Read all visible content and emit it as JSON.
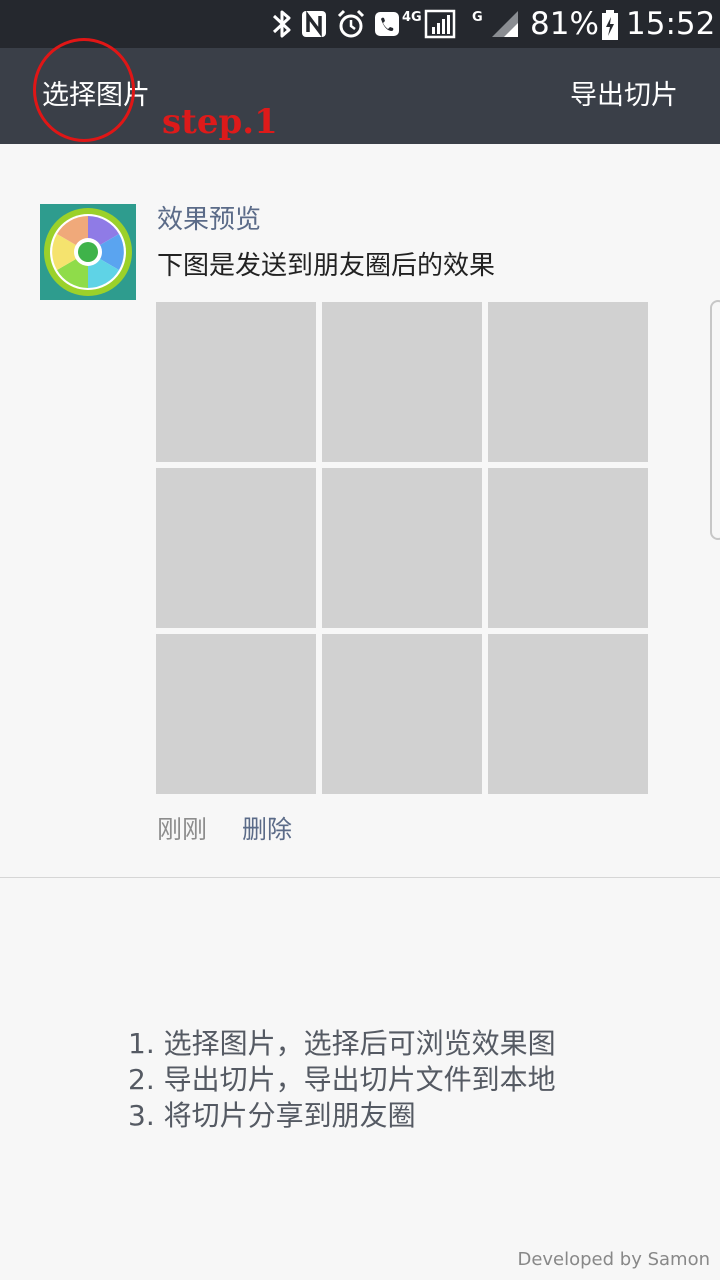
{
  "status_bar": {
    "icons": [
      "bluetooth-icon",
      "nfc-icon",
      "alarm-icon",
      "call-icon",
      "4g-signal-icon",
      "g-signal-icon",
      "battery-charging-icon"
    ],
    "network_label": "4G",
    "network2_label": "G",
    "battery": "81%",
    "time": "15:52"
  },
  "toolbar": {
    "select_label": "选择图片",
    "export_label": "导出切片"
  },
  "annotation": {
    "label": "step.1",
    "color": "#e01616"
  },
  "card": {
    "title": "效果预览",
    "description": "下图是发送到朋友圈后的效果",
    "tile_count": 9,
    "time": "刚刚",
    "delete_label": "删除"
  },
  "instructions": [
    "1. 选择图片，选择后可浏览效果图",
    "2. 导出切片，导出切片文件到本地",
    "3. 将切片分享到朋友圈"
  ],
  "footer": "Developed by Samon",
  "colors": {
    "status_bar": "#25282e",
    "app_bar": "#3a3f48",
    "background": "#f7f7f7",
    "tile": "#d1d1d1",
    "link": "#5b6b88"
  }
}
